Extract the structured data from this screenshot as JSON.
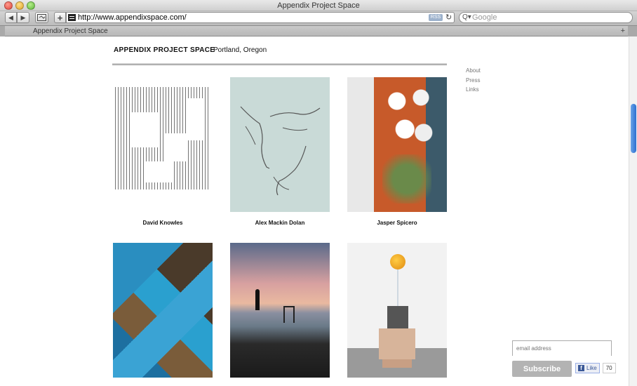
{
  "window": {
    "title": "Appendix Project Space"
  },
  "toolbar": {
    "back_icon": "◀",
    "forward_icon": "▶",
    "add_icon": "+",
    "url": "http://www.appendixspace.com/",
    "rss_label": "RSS",
    "reload_icon": "↻",
    "search_icon": "Q▾",
    "search_placeholder": "Google"
  },
  "tabbar": {
    "active_tab": "Appendix Project Space",
    "new_tab_icon": "+"
  },
  "site": {
    "name": "APPENDIX PROJECT SPACE",
    "location": "Portland, Oregon"
  },
  "sidenav": [
    "About",
    "Press",
    "Links"
  ],
  "artists": [
    {
      "name": "David Knowles"
    },
    {
      "name": "Alex Mackin Dolan"
    },
    {
      "name": "Jasper Spicero"
    }
  ],
  "subscribe": {
    "email_placeholder": "email address",
    "button_label": "Subscribe",
    "like_label": "Like",
    "like_icon": "f",
    "like_count": "70"
  }
}
